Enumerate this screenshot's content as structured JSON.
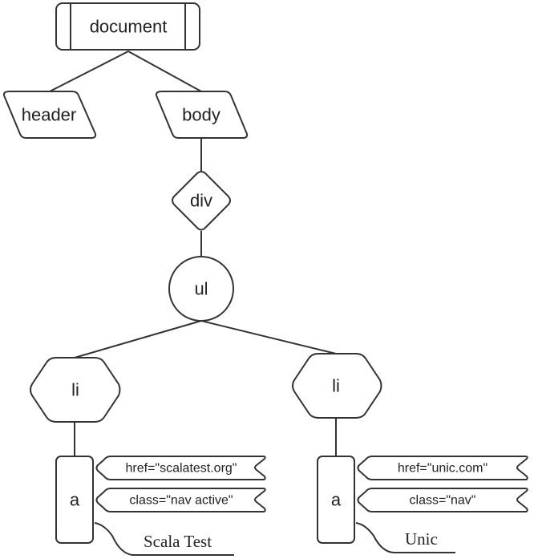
{
  "diagram": {
    "type": "DOM tree",
    "nodes": {
      "document": {
        "label": "document",
        "shape": "subprocess-rect"
      },
      "header": {
        "label": "header",
        "shape": "parallelogram"
      },
      "body": {
        "label": "body",
        "shape": "parallelogram"
      },
      "div": {
        "label": "div",
        "shape": "diamond"
      },
      "ul": {
        "label": "ul",
        "shape": "circle"
      },
      "li_left": {
        "label": "li",
        "shape": "hexagon"
      },
      "li_right": {
        "label": "li",
        "shape": "hexagon"
      },
      "a_left": {
        "label": "a",
        "shape": "rounded-rect"
      },
      "a_right": {
        "label": "a",
        "shape": "rounded-rect"
      }
    },
    "attributes": {
      "left_href": "href=\"scalatest.org\"",
      "left_class": "class=\"nav active\"",
      "right_href": "href=\"unic.com\"",
      "right_class": "class=\"nav\""
    },
    "texts": {
      "left_text": "Scala Test",
      "right_text": "Unic"
    },
    "edges": [
      [
        "document",
        "header"
      ],
      [
        "document",
        "body"
      ],
      [
        "body",
        "div"
      ],
      [
        "div",
        "ul"
      ],
      [
        "ul",
        "li_left"
      ],
      [
        "ul",
        "li_right"
      ],
      [
        "li_left",
        "a_left"
      ],
      [
        "li_right",
        "a_right"
      ]
    ]
  }
}
